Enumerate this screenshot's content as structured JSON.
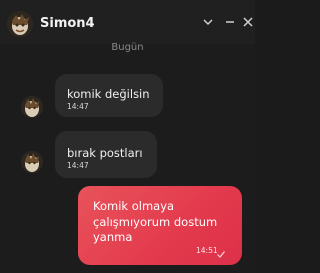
{
  "window": {
    "title": "Simon4",
    "controls": {
      "collapse_icon": "chevron-down-icon",
      "minimize_icon": "minimize-icon",
      "close_icon": "close-icon"
    }
  },
  "chat": {
    "date_separator": "Bugün",
    "messages": [
      {
        "direction": "incoming",
        "text": "komik değilsin",
        "time": "14:47"
      },
      {
        "direction": "incoming",
        "text": "bırak postları",
        "time": "14:47"
      },
      {
        "direction": "outgoing",
        "text": "Komik olmaya çalışmıyorum dostum yanma",
        "time": "14:51",
        "status_icon": "check-icon"
      }
    ]
  },
  "colors": {
    "background": "#1c1c1c",
    "incoming_bubble": "#2b2b2b",
    "outgoing_bubble": "#e33a4d"
  }
}
